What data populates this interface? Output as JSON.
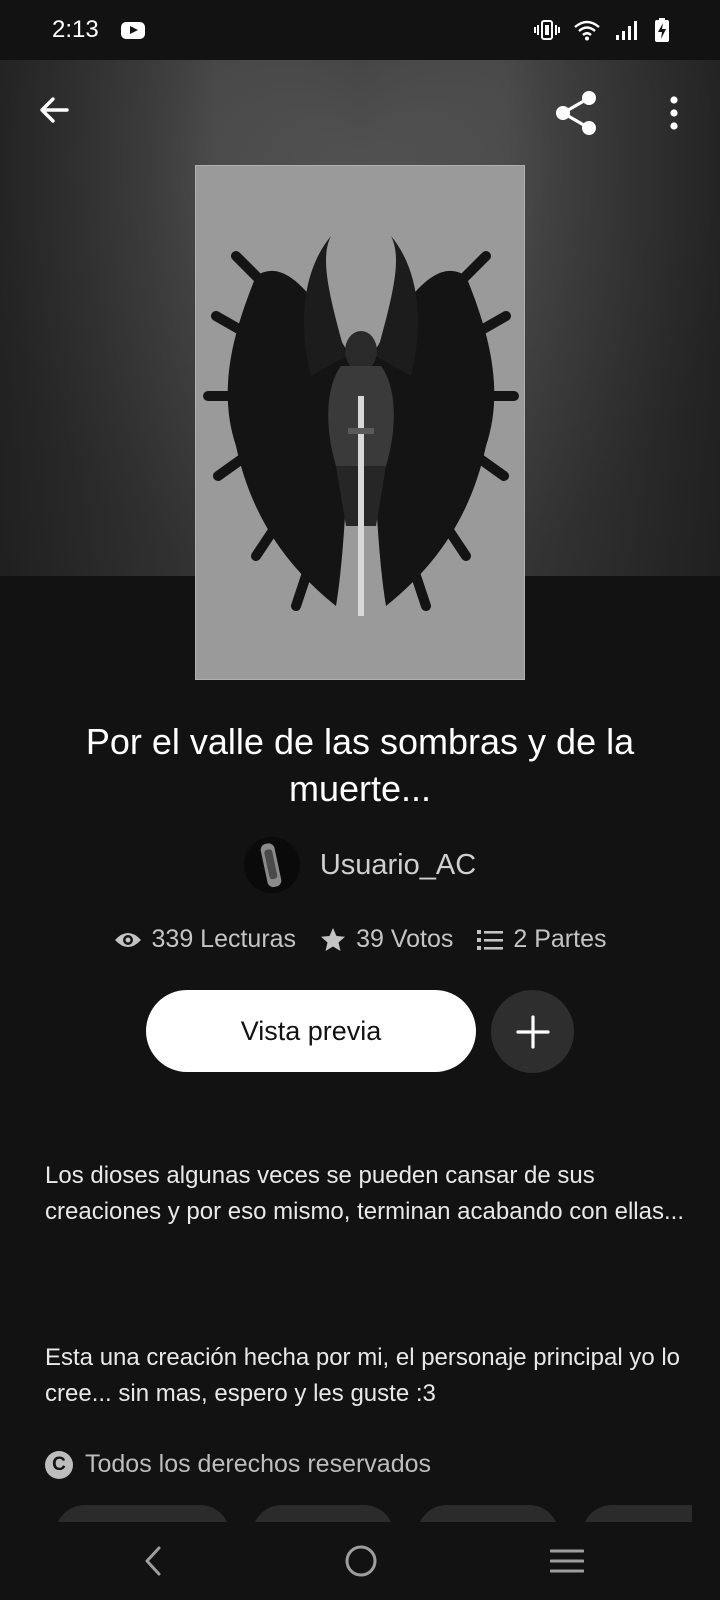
{
  "status_bar": {
    "time": "2:13",
    "icons": [
      "youtube-icon",
      "vibrate-icon",
      "wifi-icon",
      "signal-icon",
      "battery-charging-icon"
    ]
  },
  "topbar": {
    "icons": [
      "back-arrow-icon",
      "share-icon",
      "more-vertical-icon"
    ]
  },
  "story": {
    "title": "Por el valle de las sombras y de la muerte...",
    "author": "Usuario_AC",
    "stats": {
      "reads": "339 Lecturas",
      "votes": "39 Votos",
      "parts": "2 Partes"
    },
    "preview_button": "Vista previa",
    "description_p1": "Los dioses algunas veces se pueden cansar de sus creaciones y por eso mismo, terminan acabando con ellas...",
    "description_p2": "Esta una creación hecha por mi, el personaje principal yo lo cree... sin mas, espero y les guste :3",
    "copyright": "Todos los derechos reservados"
  },
  "nav_bar": {
    "icons": [
      "nav-back-icon",
      "nav-home-icon",
      "nav-recents-icon"
    ]
  },
  "colors": {
    "background": "#121212",
    "button_primary": "#ffffff",
    "button_secondary": "#2e2e2e"
  }
}
